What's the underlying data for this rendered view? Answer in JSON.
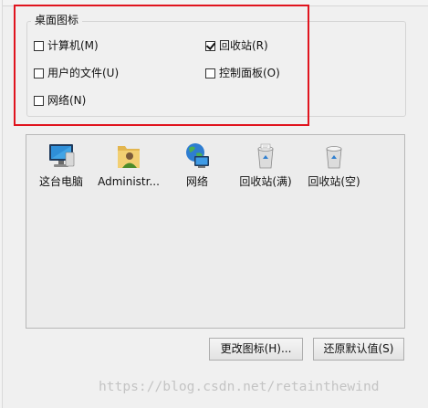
{
  "desktop_icons": {
    "group_title": "桌面图标",
    "checkboxes": [
      {
        "label": "计算机(M)",
        "checked": false
      },
      {
        "label": "回收站(R)",
        "checked": true
      },
      {
        "label": "用户的文件(U)",
        "checked": false
      },
      {
        "label": "控制面板(O)",
        "checked": false
      },
      {
        "label": "网络(N)",
        "checked": false
      }
    ]
  },
  "icon_list": [
    {
      "label": "这台电脑",
      "icon": "this-pc-icon"
    },
    {
      "label": "Administr...",
      "icon": "user-folder-icon"
    },
    {
      "label": "网络",
      "icon": "network-globe-icon"
    },
    {
      "label": "回收站(满)",
      "icon": "recycle-bin-full-icon"
    },
    {
      "label": "回收站(空)",
      "icon": "recycle-bin-empty-icon"
    }
  ],
  "buttons": {
    "change_icon": "更改图标(H)...",
    "restore_default": "还原默认值(S)"
  },
  "watermark": "https://blog.csdn.net/retainthewind",
  "colors": {
    "highlight_border": "#e0141e",
    "background": "#f0f0f0"
  }
}
